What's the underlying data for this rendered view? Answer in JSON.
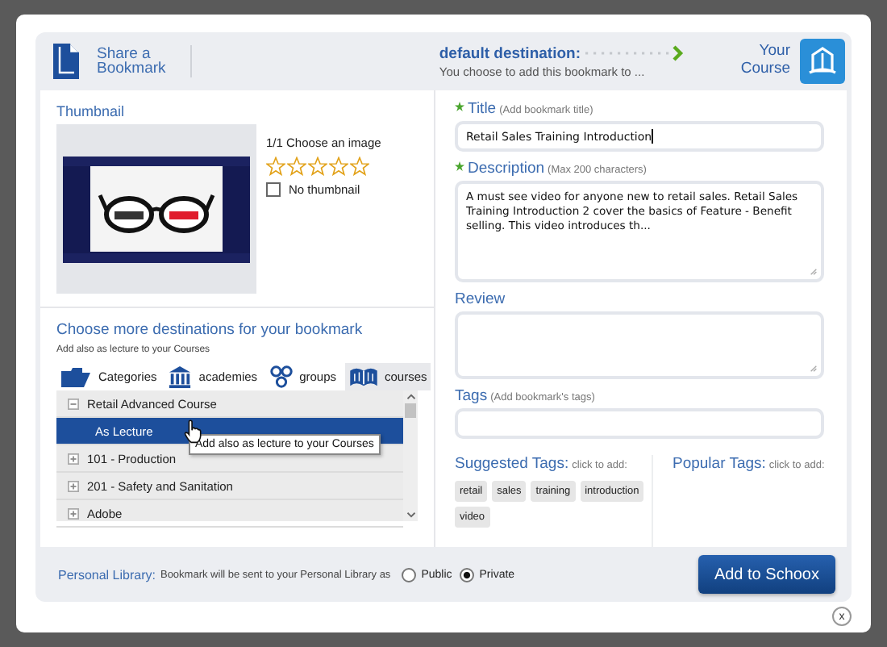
{
  "header": {
    "title": "Share a Bookmark",
    "destination_label": "default destination:",
    "destination_note": "You choose to add this bookmark to ...",
    "destination": "Your Course"
  },
  "thumbnail": {
    "heading": "Thumbnail",
    "counter": "1/1 Choose an image",
    "stars": 0,
    "no_thumbnail": {
      "label": "No thumbnail",
      "checked": false
    }
  },
  "destinations": {
    "heading": "Choose more destinations for your bookmark",
    "note": "Add also as lecture to your Courses",
    "tabs": [
      {
        "label": "Categories",
        "kind": "folder",
        "selected": false
      },
      {
        "label": "academies",
        "kind": "academy",
        "selected": false
      },
      {
        "label": "groups",
        "kind": "groups",
        "selected": false
      },
      {
        "label": "courses",
        "kind": "courses",
        "selected": true
      }
    ],
    "items": [
      {
        "label": "Retail Advanced Course",
        "expanded": true,
        "children": [
          {
            "label": "As Lecture",
            "selected": true
          }
        ]
      },
      {
        "label": "101 - Production",
        "expanded": false
      },
      {
        "label": "201 - Safety and Sanitation",
        "expanded": false
      },
      {
        "label": "Adobe",
        "expanded": false
      }
    ],
    "tooltip": "Add also as lecture to your Courses"
  },
  "fields": [
    {
      "label": "Title",
      "hint": "(Add bookmark title)",
      "required": true,
      "kind": "input",
      "value": "Retail Sales Training Introduction"
    },
    {
      "label": "Description",
      "hint": "(Max 200 characters)",
      "required": true,
      "kind": "textarea",
      "value": "A must see video for anyone new to retail sales. Retail Sales Training Introduction 2 cover the basics of Feature - Benefit selling. This video introduces th..."
    },
    {
      "label": "Review",
      "required": false,
      "kind": "textarea"
    },
    {
      "label": "Tags",
      "hint": "(Add bookmark's tags)",
      "required": false,
      "kind": "input"
    }
  ],
  "suggested_tags": {
    "label": "Suggested Tags:",
    "hint": "click to add:",
    "tags": [
      "retail",
      "sales",
      "training",
      "introduction",
      "video"
    ]
  },
  "popular_tags": {
    "label": "Popular Tags:",
    "hint": "click to add:"
  },
  "footer": {
    "label": "Personal Library:",
    "note": "Bookmark will be sent to your Personal Library as",
    "options": [
      {
        "label": "Public",
        "selected": false
      },
      {
        "label": "Private",
        "selected": true
      }
    ],
    "button": "Add to Schoox"
  },
  "close": "x"
}
